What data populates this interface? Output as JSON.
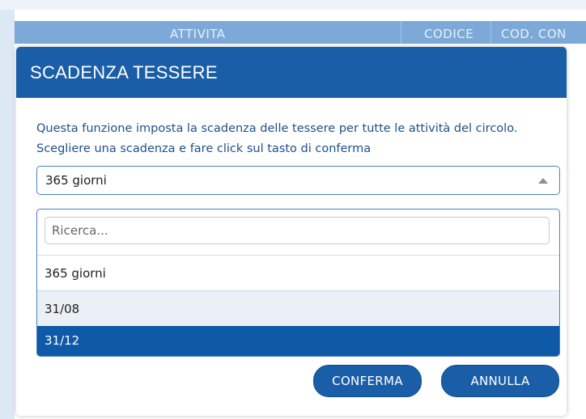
{
  "background": {
    "columns": [
      "ATTIVITA",
      "CODICE",
      "COD. CON"
    ]
  },
  "modal": {
    "title": "SCADENZA TESSERE",
    "description": "Questa funzione imposta la scadenza delle tessere per tutte le attività del circolo. Scegliere una scadenza e fare click sul tasto di conferma",
    "select": {
      "selected": "365 giorni",
      "search_placeholder": "Ricerca...",
      "options": [
        "365 giorni",
        "31/08",
        "31/12"
      ],
      "highlighted_option": "31/12"
    },
    "buttons": {
      "confirm": "CONFERMA",
      "cancel": "ANNULLA"
    }
  },
  "colors": {
    "primary": "#1b5ea8",
    "header_bg": "#7da9d8",
    "highlight": "#0e5aa7"
  }
}
